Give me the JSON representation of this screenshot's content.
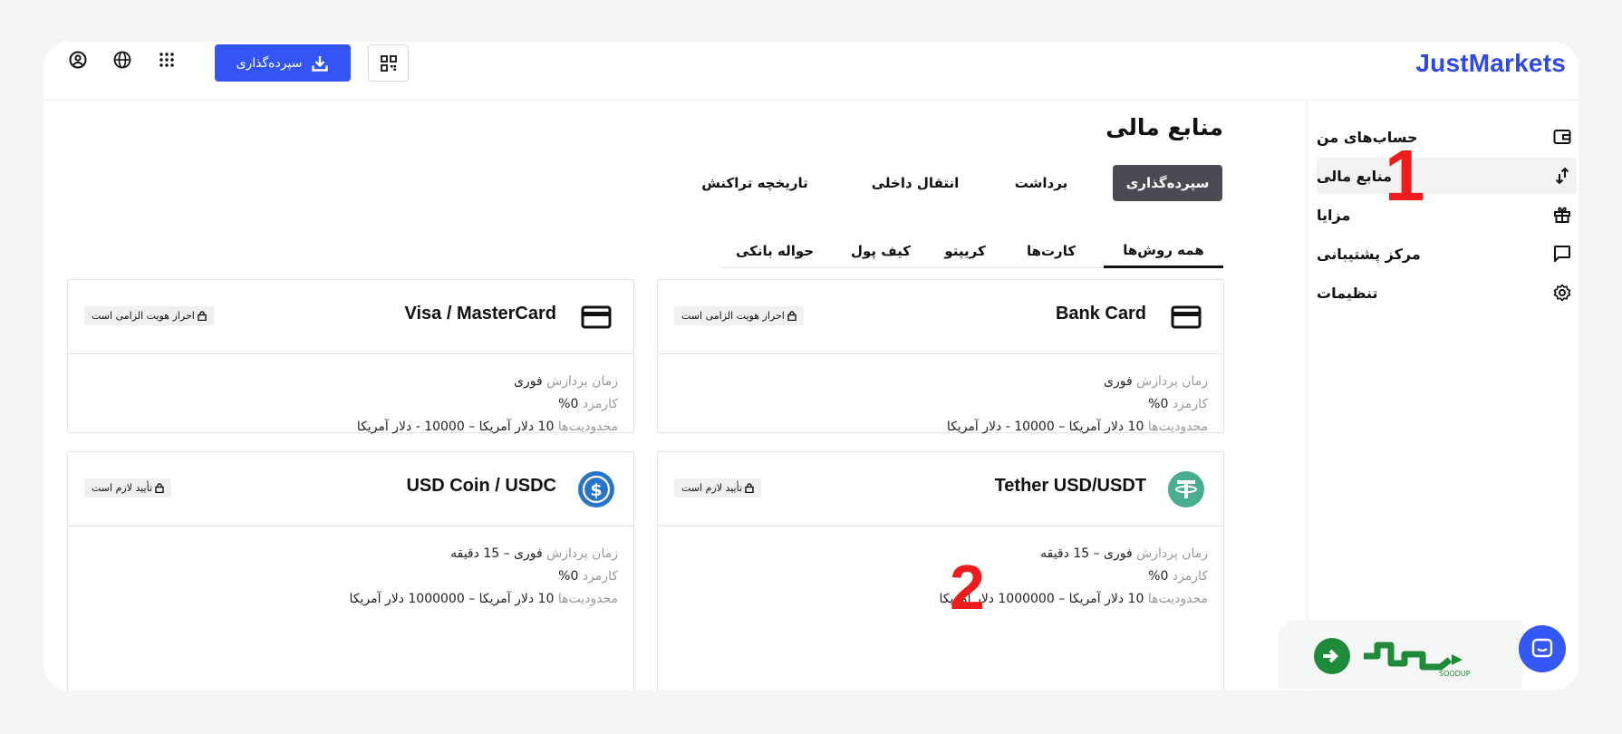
{
  "app": {
    "brand": "JustMarkets",
    "brand_color": "#2f49e8"
  },
  "topbar": {
    "deposit_label": "سپرده‌گذاری",
    "icons": [
      "profile-icon",
      "globe-icon",
      "apps-grid-icon",
      "download-icon",
      "qr-code-icon"
    ]
  },
  "sidebar": {
    "items": [
      {
        "label": "حساب‌های من",
        "icon": "wallet-icon",
        "active": false
      },
      {
        "label": "منابع مالی",
        "icon": "transfer-arrows-icon",
        "active": true
      },
      {
        "label": "مزایا",
        "icon": "gift-icon",
        "active": false
      },
      {
        "label": "مرکز پشتیبانی",
        "icon": "chat-icon",
        "active": false
      },
      {
        "label": "تنظیمات",
        "icon": "gear-icon",
        "active": false
      }
    ]
  },
  "main": {
    "title": "منابع مالی",
    "tabs": [
      "سپرده‌گذاری",
      "برداشت",
      "انتقال داخلی",
      "تاریخچه تراکنش"
    ],
    "subtabs": [
      "همه روش‌ها",
      "کارت‌ها",
      "کریپتو",
      "کیف پول",
      "حواله بانکی"
    ],
    "cards": [
      {
        "title": "Bank Card",
        "icon": "credit-card-icon",
        "badge": "احراز هویت الزامی است",
        "time_key": "زمان پردازش",
        "time_val": "فوری",
        "fee_key": "کارمزد",
        "fee_val": "0%",
        "limits_key": "محدودیت‌ها",
        "limits_val": "10 دلار آمریکا – 10000 - دلار آمریکا"
      },
      {
        "title": "Visa / MasterCard",
        "icon": "credit-card-icon",
        "badge": "احراز هویت الزامی است",
        "time_key": "زمان پردازش",
        "time_val": "فوری",
        "fee_key": "کارمزد",
        "fee_val": "0%",
        "limits_key": "محدودیت‌ها",
        "limits_val": "10 دلار آمریکا – 10000 - دلار آمریکا"
      },
      {
        "title": "Tether USD/USDT",
        "icon": "tether-icon",
        "badge": "تأیید لازم است",
        "time_key": "زمان پردازش",
        "time_val": "فوری – 15 دقیقه",
        "fee_key": "کارمزد",
        "fee_val": "0%",
        "limits_key": "محدودیت‌ها",
        "limits_val": "10 دلار آمریکا – 1000000 دلار آمریکا"
      },
      {
        "title": "USD Coin / USDC",
        "icon": "usdc-icon",
        "badge": "تأیید لازم است",
        "time_key": "زمان پردازش",
        "time_val": "فوری – 15 دقیقه",
        "fee_key": "کارمزد",
        "fee_val": "0%",
        "limits_key": "محدودیت‌ها",
        "limits_val": "10 دلار آمریکا – 1000000 دلار آمریکا"
      }
    ]
  },
  "annotations": {
    "one": "1",
    "two": "2"
  },
  "watermark": {
    "brand_text": "SOODUP",
    "colors": {
      "green": "#1e8a3a"
    }
  },
  "colors": {
    "accent": "#3355f6",
    "active_tab": "#4a4a52",
    "annotation": "#ee1c1c"
  }
}
